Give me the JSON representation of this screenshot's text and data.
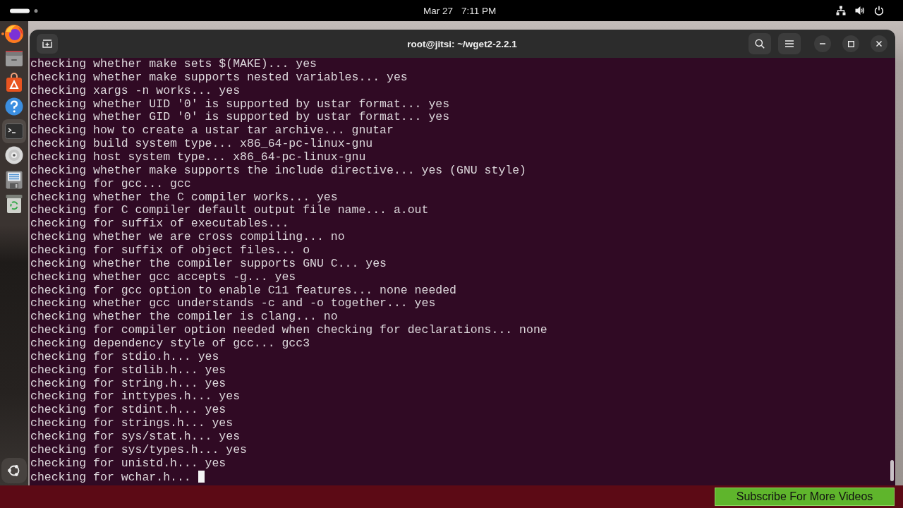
{
  "top_bar": {
    "date": "Mar 27",
    "time": "7:11 PM"
  },
  "dock": {
    "items": [
      {
        "kind": "browser",
        "running": true,
        "selected": false
      },
      {
        "kind": "files",
        "running": false,
        "selected": false
      },
      {
        "kind": "app_center",
        "running": false,
        "selected": false
      },
      {
        "kind": "help",
        "running": false,
        "selected": false
      },
      {
        "kind": "terminal",
        "running": false,
        "selected": true
      },
      {
        "kind": "disc",
        "running": false,
        "selected": false
      },
      {
        "kind": "floppy",
        "running": false,
        "selected": false
      },
      {
        "kind": "trash",
        "running": false,
        "selected": false
      }
    ]
  },
  "window": {
    "title": "root@jitsi: ~/wget2-2.2.1"
  },
  "terminal": {
    "lines": [
      "checking whether make sets $(MAKE)... yes",
      "checking whether make supports nested variables... yes",
      "checking xargs -n works... yes",
      "checking whether UID '0' is supported by ustar format... yes",
      "checking whether GID '0' is supported by ustar format... yes",
      "checking how to create a ustar tar archive... gnutar",
      "checking build system type... x86_64-pc-linux-gnu",
      "checking host system type... x86_64-pc-linux-gnu",
      "checking whether make supports the include directive... yes (GNU style)",
      "checking for gcc... gcc",
      "checking whether the C compiler works... yes",
      "checking for C compiler default output file name... a.out",
      "checking for suffix of executables...",
      "checking whether we are cross compiling... no",
      "checking for suffix of object files... o",
      "checking whether the compiler supports GNU C... yes",
      "checking whether gcc accepts -g... yes",
      "checking for gcc option to enable C11 features... none needed",
      "checking whether gcc understands -c and -o together... yes",
      "checking whether the compiler is clang... no",
      "checking for compiler option needed when checking for declarations... none",
      "checking dependency style of gcc... gcc3",
      "checking for stdio.h... yes",
      "checking for stdlib.h... yes",
      "checking for string.h... yes",
      "checking for inttypes.h... yes",
      "checking for stdint.h... yes",
      "checking for strings.h... yes",
      "checking for sys/stat.h... yes",
      "checking for sys/types.h... yes",
      "checking for unistd.h... yes",
      "checking for wchar.h..."
    ],
    "cursor": true
  },
  "banner": {
    "text": "Subscribe For More Videos"
  }
}
